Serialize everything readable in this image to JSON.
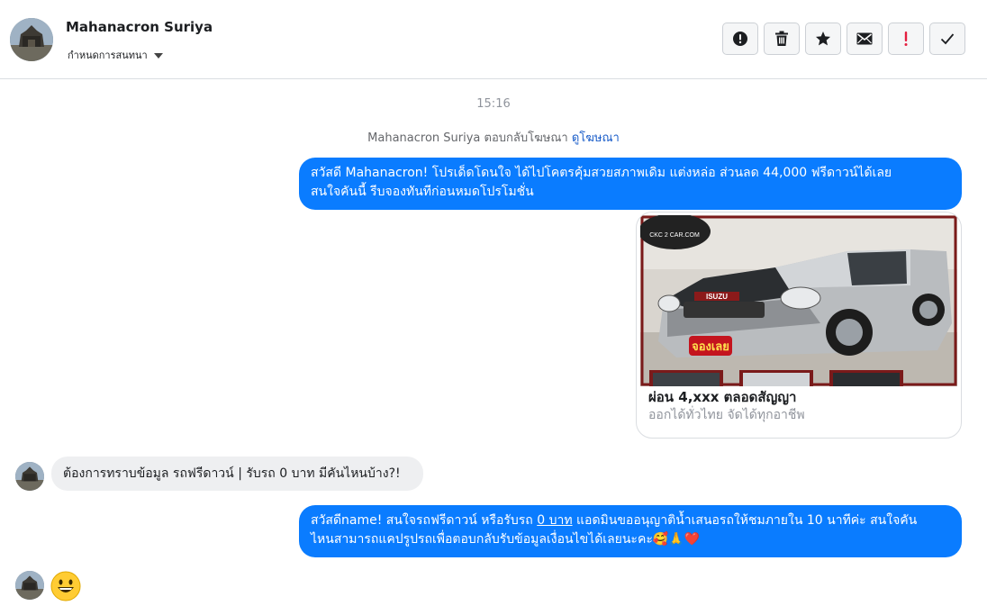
{
  "header": {
    "contact_name": "Mahanacron Suriya",
    "assign_label": "กำหนดการสนทนา",
    "toolbar": [
      {
        "name": "spam-button",
        "icon": "alert-circle-icon"
      },
      {
        "name": "delete-button",
        "icon": "trash-icon"
      },
      {
        "name": "star-button",
        "icon": "star-icon"
      },
      {
        "name": "mark-unread-button",
        "icon": "envelope-icon"
      },
      {
        "name": "follow-up-button",
        "icon": "exclamation-icon"
      },
      {
        "name": "done-button",
        "icon": "checkmark-icon"
      }
    ]
  },
  "conversation": {
    "timestamp": "15:16",
    "reply_note": {
      "text": "Mahanacron Suriya ตอบกลับโฆษณา",
      "link": "ดูโฆษณา"
    },
    "messages": [
      {
        "direction": "out",
        "line1": "สวัสดี Mahanacron! โปรเด็ดโดนใจ ได้ไปโคตรคุ้มสวยสภาพเดิม แต่งหล่อ  ส่วนลด 44,000 ฟรีดาวน์ได้เลย",
        "line2": "สนใจคันนี้ รีบจองทันทีก่อนหมดโปรโมชั่น"
      },
      {
        "direction": "out-card",
        "image_label": "จองเลย",
        "brand_text": "CKC 2 CAR.COM",
        "grille_text": "ISUZU",
        "title": "ผ่อน 4,xxx ตลอดสัญญา",
        "subtitle": "ออกได้ทั่วไทย จัดได้ทุกอาชีพ"
      },
      {
        "direction": "in",
        "text": "ต้องการทราบข้อมูล รถฟรีดาวน์ | รับรถ 0 บาท มีคันไหนบ้าง?!"
      },
      {
        "direction": "out",
        "line1_a": "สวัสดีname! สนใจรถฟรีดาวน์ หรือรับรถ ",
        "line1_link": "0 บาท",
        "line1_b": " แอดมินขออนุญาติน้ำเสนอรถให้ชมภายใน 10 นาทีค่ะ สนใจคัน",
        "line2": "ไหนสามารถแคปรูปรถเพื่อตอบกลับรับข้อมูลเงื่อนไขได้เลยนะคะ🥰🙏❤️"
      },
      {
        "direction": "in-emoji",
        "emoji": "grinning-face-icon"
      }
    ]
  },
  "colors": {
    "outgoing_bubble": "#0a7cff",
    "incoming_bubble": "#eeeff1",
    "link": "#1a5dc9",
    "muted_text": "#90949c",
    "follow_up_red": "#e41e3f"
  }
}
